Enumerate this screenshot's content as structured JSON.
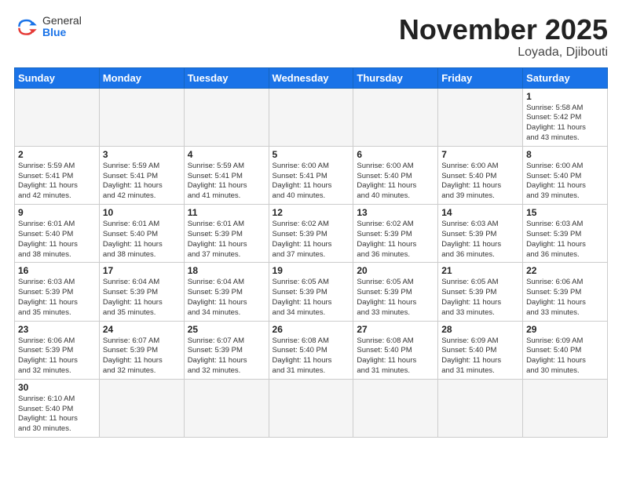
{
  "header": {
    "logo_general": "General",
    "logo_blue": "Blue",
    "title": "November 2025",
    "location": "Loyada, Djibouti"
  },
  "weekdays": [
    "Sunday",
    "Monday",
    "Tuesday",
    "Wednesday",
    "Thursday",
    "Friday",
    "Saturday"
  ],
  "weeks": [
    [
      {
        "day": "",
        "info": ""
      },
      {
        "day": "",
        "info": ""
      },
      {
        "day": "",
        "info": ""
      },
      {
        "day": "",
        "info": ""
      },
      {
        "day": "",
        "info": ""
      },
      {
        "day": "",
        "info": ""
      },
      {
        "day": "1",
        "info": "Sunrise: 5:58 AM\nSunset: 5:42 PM\nDaylight: 11 hours\nand 43 minutes."
      }
    ],
    [
      {
        "day": "2",
        "info": "Sunrise: 5:59 AM\nSunset: 5:41 PM\nDaylight: 11 hours\nand 42 minutes."
      },
      {
        "day": "3",
        "info": "Sunrise: 5:59 AM\nSunset: 5:41 PM\nDaylight: 11 hours\nand 42 minutes."
      },
      {
        "day": "4",
        "info": "Sunrise: 5:59 AM\nSunset: 5:41 PM\nDaylight: 11 hours\nand 41 minutes."
      },
      {
        "day": "5",
        "info": "Sunrise: 6:00 AM\nSunset: 5:41 PM\nDaylight: 11 hours\nand 40 minutes."
      },
      {
        "day": "6",
        "info": "Sunrise: 6:00 AM\nSunset: 5:40 PM\nDaylight: 11 hours\nand 40 minutes."
      },
      {
        "day": "7",
        "info": "Sunrise: 6:00 AM\nSunset: 5:40 PM\nDaylight: 11 hours\nand 39 minutes."
      },
      {
        "day": "8",
        "info": "Sunrise: 6:00 AM\nSunset: 5:40 PM\nDaylight: 11 hours\nand 39 minutes."
      }
    ],
    [
      {
        "day": "9",
        "info": "Sunrise: 6:01 AM\nSunset: 5:40 PM\nDaylight: 11 hours\nand 38 minutes."
      },
      {
        "day": "10",
        "info": "Sunrise: 6:01 AM\nSunset: 5:40 PM\nDaylight: 11 hours\nand 38 minutes."
      },
      {
        "day": "11",
        "info": "Sunrise: 6:01 AM\nSunset: 5:39 PM\nDaylight: 11 hours\nand 37 minutes."
      },
      {
        "day": "12",
        "info": "Sunrise: 6:02 AM\nSunset: 5:39 PM\nDaylight: 11 hours\nand 37 minutes."
      },
      {
        "day": "13",
        "info": "Sunrise: 6:02 AM\nSunset: 5:39 PM\nDaylight: 11 hours\nand 36 minutes."
      },
      {
        "day": "14",
        "info": "Sunrise: 6:03 AM\nSunset: 5:39 PM\nDaylight: 11 hours\nand 36 minutes."
      },
      {
        "day": "15",
        "info": "Sunrise: 6:03 AM\nSunset: 5:39 PM\nDaylight: 11 hours\nand 36 minutes."
      }
    ],
    [
      {
        "day": "16",
        "info": "Sunrise: 6:03 AM\nSunset: 5:39 PM\nDaylight: 11 hours\nand 35 minutes."
      },
      {
        "day": "17",
        "info": "Sunrise: 6:04 AM\nSunset: 5:39 PM\nDaylight: 11 hours\nand 35 minutes."
      },
      {
        "day": "18",
        "info": "Sunrise: 6:04 AM\nSunset: 5:39 PM\nDaylight: 11 hours\nand 34 minutes."
      },
      {
        "day": "19",
        "info": "Sunrise: 6:05 AM\nSunset: 5:39 PM\nDaylight: 11 hours\nand 34 minutes."
      },
      {
        "day": "20",
        "info": "Sunrise: 6:05 AM\nSunset: 5:39 PM\nDaylight: 11 hours\nand 33 minutes."
      },
      {
        "day": "21",
        "info": "Sunrise: 6:05 AM\nSunset: 5:39 PM\nDaylight: 11 hours\nand 33 minutes."
      },
      {
        "day": "22",
        "info": "Sunrise: 6:06 AM\nSunset: 5:39 PM\nDaylight: 11 hours\nand 33 minutes."
      }
    ],
    [
      {
        "day": "23",
        "info": "Sunrise: 6:06 AM\nSunset: 5:39 PM\nDaylight: 11 hours\nand 32 minutes."
      },
      {
        "day": "24",
        "info": "Sunrise: 6:07 AM\nSunset: 5:39 PM\nDaylight: 11 hours\nand 32 minutes."
      },
      {
        "day": "25",
        "info": "Sunrise: 6:07 AM\nSunset: 5:39 PM\nDaylight: 11 hours\nand 32 minutes."
      },
      {
        "day": "26",
        "info": "Sunrise: 6:08 AM\nSunset: 5:40 PM\nDaylight: 11 hours\nand 31 minutes."
      },
      {
        "day": "27",
        "info": "Sunrise: 6:08 AM\nSunset: 5:40 PM\nDaylight: 11 hours\nand 31 minutes."
      },
      {
        "day": "28",
        "info": "Sunrise: 6:09 AM\nSunset: 5:40 PM\nDaylight: 11 hours\nand 31 minutes."
      },
      {
        "day": "29",
        "info": "Sunrise: 6:09 AM\nSunset: 5:40 PM\nDaylight: 11 hours\nand 30 minutes."
      }
    ],
    [
      {
        "day": "30",
        "info": "Sunrise: 6:10 AM\nSunset: 5:40 PM\nDaylight: 11 hours\nand 30 minutes."
      },
      {
        "day": "",
        "info": ""
      },
      {
        "day": "",
        "info": ""
      },
      {
        "day": "",
        "info": ""
      },
      {
        "day": "",
        "info": ""
      },
      {
        "day": "",
        "info": ""
      },
      {
        "day": "",
        "info": ""
      }
    ]
  ]
}
